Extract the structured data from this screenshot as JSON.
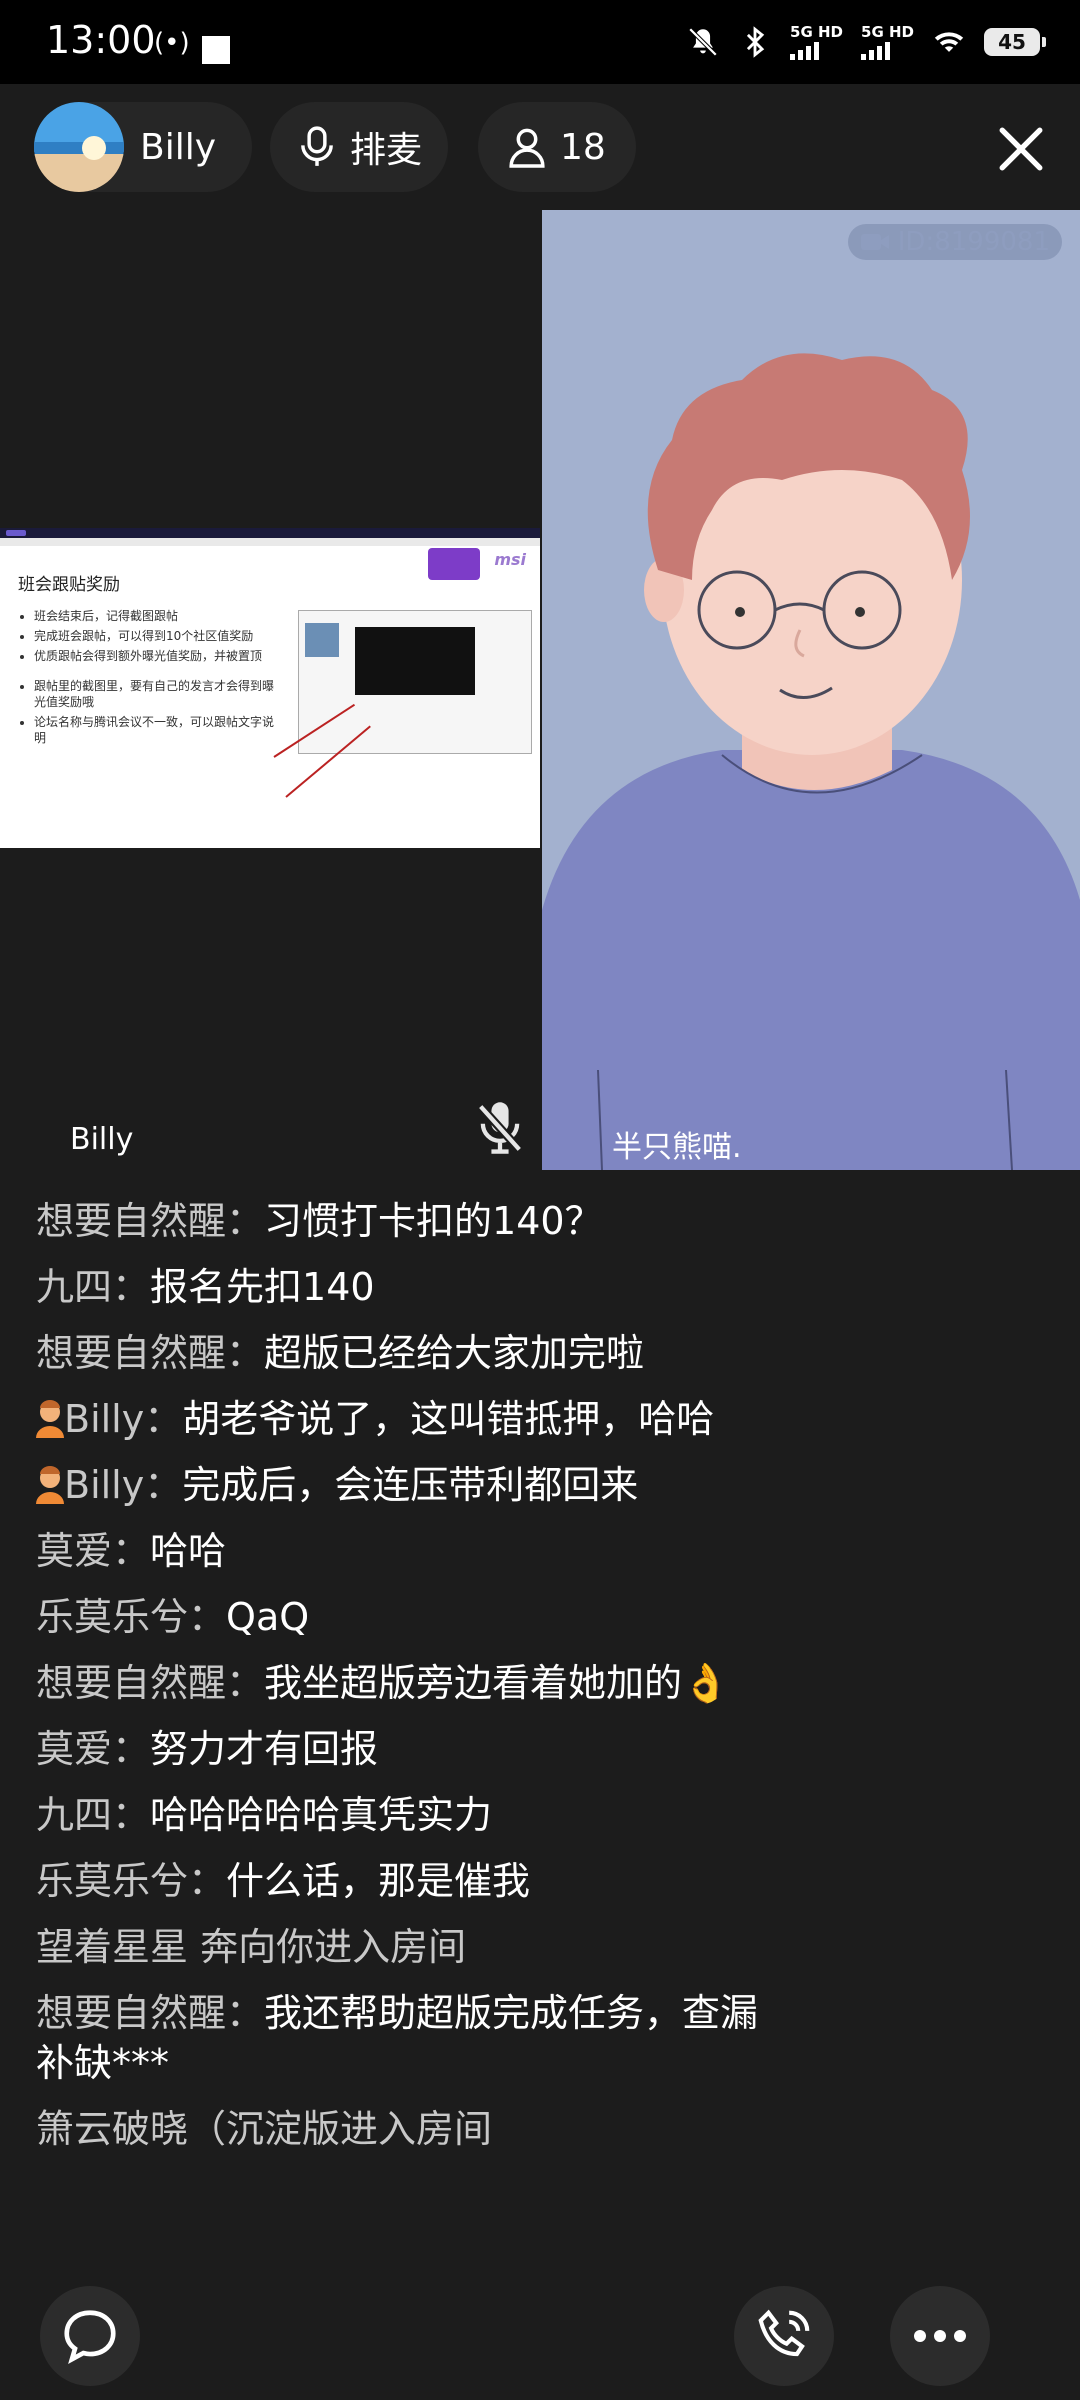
{
  "status_bar": {
    "time": "13:00",
    "battery": "45",
    "network_1": "5G HD",
    "network_2": "5G HD"
  },
  "header": {
    "host_name": "Billy",
    "mic_queue_label": "排麦",
    "audience_count": "18"
  },
  "stage": {
    "room_id": "ID:8199081",
    "left_label": "Billy",
    "right_label": "半只熊喵.",
    "slide": {
      "title": "班会跟贴奖励",
      "bullets": [
        "班会结束后，记得截图跟帖",
        "完成班会跟帖，可以得到10个社区值奖励",
        "优质跟帖会得到额外曝光值奖励，并被置顶",
        "跟帖里的截图里，要有自己的发言才会得到曝光值奖励哦",
        "论坛名称与腾讯会议不一致，可以跟帖文字说明"
      ],
      "brand": "msi"
    }
  },
  "chat": [
    {
      "user": "想要自然醒",
      "text": "习惯打卡扣的140？",
      "icon": false
    },
    {
      "user": "九四",
      "text": "报名先扣140",
      "icon": false
    },
    {
      "user": "想要自然醒",
      "text": "超版已经给大家加完啦",
      "icon": false
    },
    {
      "user": "Billy",
      "text": "胡老爷说了，这叫错抵押，哈哈",
      "icon": true
    },
    {
      "user": "Billy",
      "text": "完成后，会连压带利都回来",
      "icon": true
    },
    {
      "user": "莫爱",
      "text": "哈哈",
      "icon": false
    },
    {
      "user": "乐莫乐兮",
      "text": "QaQ",
      "icon": false
    },
    {
      "user": "想要自然醒",
      "text": "我坐超版旁边看着她加的👌",
      "icon": false
    },
    {
      "user": "莫爱",
      "text": "努力才有回报",
      "icon": false
    },
    {
      "user": "九四",
      "text": "哈哈哈哈哈真凭实力",
      "icon": false
    },
    {
      "user": "乐莫乐兮",
      "text": "什么话，那是催我",
      "icon": false
    },
    {
      "user": "",
      "text": "望着星星 奔向你进入房间",
      "icon": false
    },
    {
      "user": "想要自然醒",
      "text": "我还帮助超版完成任务，查漏补缺***",
      "icon": false
    },
    {
      "user": "",
      "text": "箫云破晓（沉淀版进入房间",
      "icon": false
    }
  ],
  "colors": {
    "background": "#1c1c1c",
    "video_bg": "#a3b1cf",
    "pill": "#262626"
  }
}
